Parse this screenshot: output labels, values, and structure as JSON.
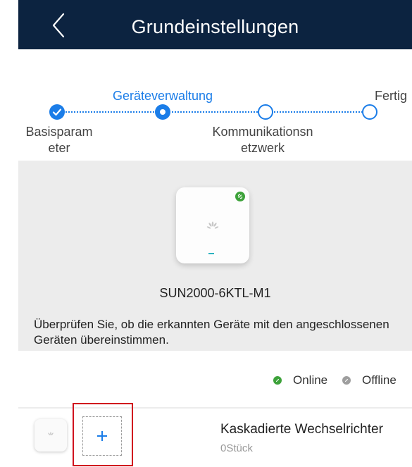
{
  "header": {
    "title": "Grundeinstellungen",
    "back_icon": "chevron-left-icon",
    "background": "#0c2340"
  },
  "stepper": {
    "accent_color": "#1b7de8",
    "steps": [
      {
        "label_lines": [
          "Basisparam",
          "eter"
        ],
        "state": "completed"
      },
      {
        "label_lines": [
          "Geräteverwaltung"
        ],
        "state": "active"
      },
      {
        "label_lines": [
          "Kommunikationsn",
          "etzwerk"
        ],
        "state": "pending"
      },
      {
        "label_lines": [
          "Fertig"
        ],
        "state": "pending"
      }
    ]
  },
  "device": {
    "name": "SUN2000-6KTL-M1",
    "status": "Online",
    "status_color": "#3da23a",
    "icon": "inverter-icon"
  },
  "hint": "Überprüfen Sie, ob die erkannten Geräte mit den angeschlossenen Geräten übereinstimmen.",
  "legend": {
    "online_label": "Online",
    "offline_label": "Offline",
    "online_color": "#3da23a",
    "offline_color": "#9e9e9e"
  },
  "cascade": {
    "title": "Kaskadierte Wechselrichter",
    "count": "0Stück",
    "add_icon": "plus-icon",
    "highlight_color": "#d0121e"
  }
}
